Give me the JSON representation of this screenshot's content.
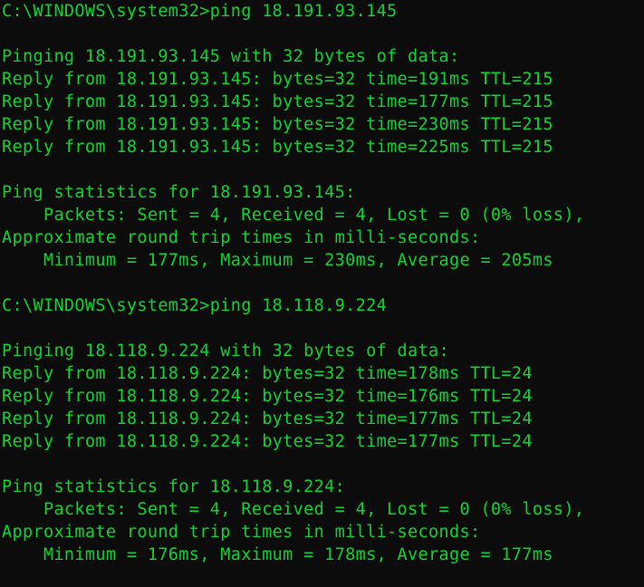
{
  "terminal": {
    "colors": {
      "background": "#0c0c0c",
      "foreground": "#13d334"
    },
    "lines": [
      "C:\\WINDOWS\\system32>ping 18.191.93.145",
      "",
      "Pinging 18.191.93.145 with 32 bytes of data:",
      "Reply from 18.191.93.145: bytes=32 time=191ms TTL=215",
      "Reply from 18.191.93.145: bytes=32 time=177ms TTL=215",
      "Reply from 18.191.93.145: bytes=32 time=230ms TTL=215",
      "Reply from 18.191.93.145: bytes=32 time=225ms TTL=215",
      "",
      "Ping statistics for 18.191.93.145:",
      "    Packets: Sent = 4, Received = 4, Lost = 0 (0% loss),",
      "Approximate round trip times in milli-seconds:",
      "    Minimum = 177ms, Maximum = 230ms, Average = 205ms",
      "",
      "C:\\WINDOWS\\system32>ping 18.118.9.224",
      "",
      "Pinging 18.118.9.224 with 32 bytes of data:",
      "Reply from 18.118.9.224: bytes=32 time=178ms TTL=24",
      "Reply from 18.118.9.224: bytes=32 time=176ms TTL=24",
      "Reply from 18.118.9.224: bytes=32 time=177ms TTL=24",
      "Reply from 18.118.9.224: bytes=32 time=177ms TTL=24",
      "",
      "Ping statistics for 18.118.9.224:",
      "    Packets: Sent = 4, Received = 4, Lost = 0 (0% loss),",
      "Approximate round trip times in milli-seconds:",
      "    Minimum = 176ms, Maximum = 178ms, Average = 177ms"
    ]
  }
}
